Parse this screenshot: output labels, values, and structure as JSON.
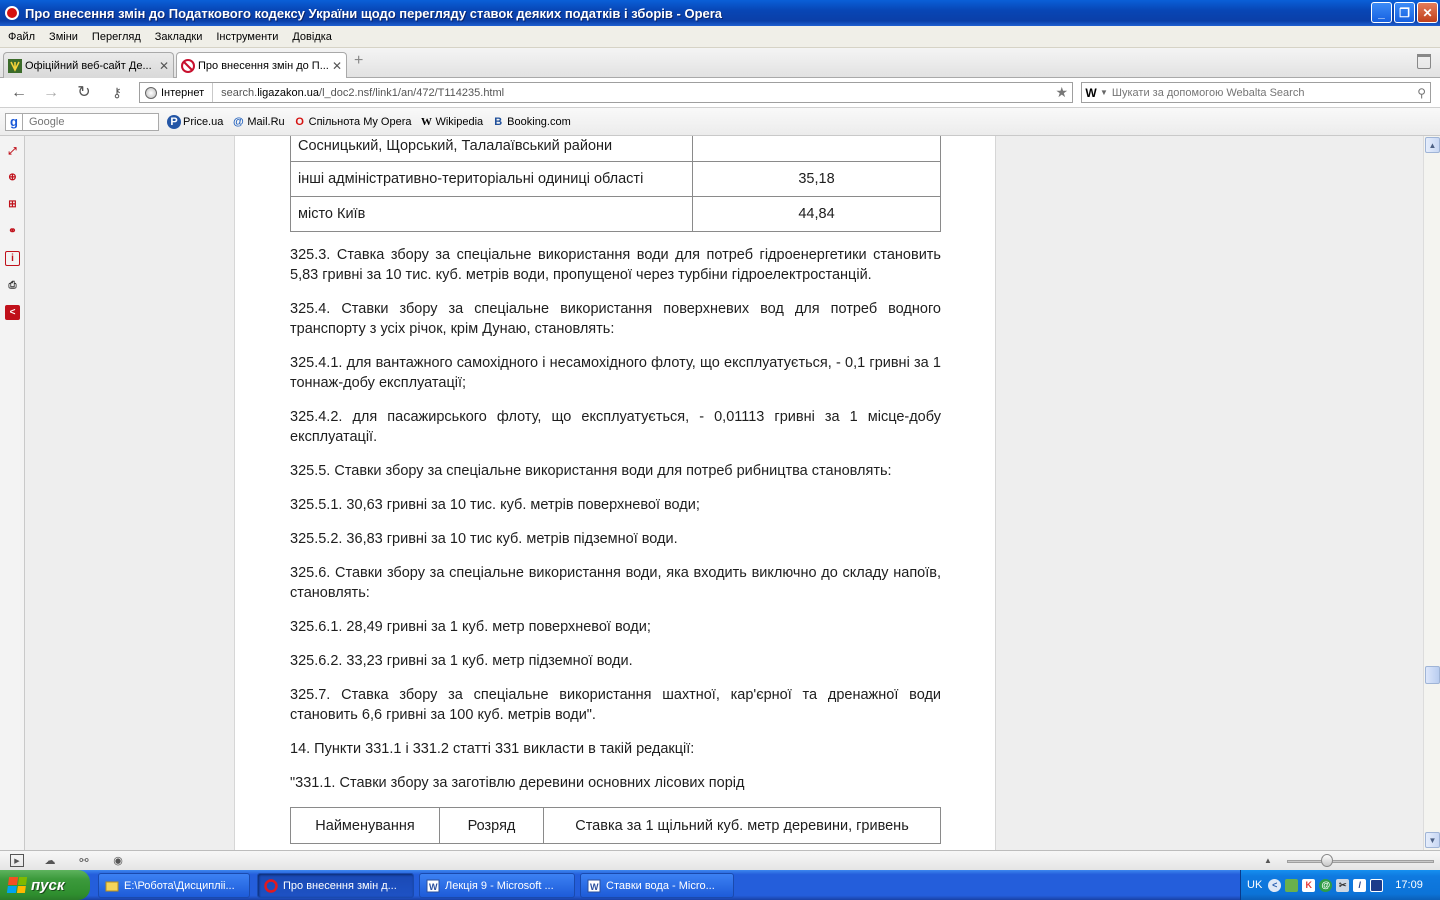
{
  "window": {
    "title": "Про внесення змін до Податкового кодексу України щодо перегляду ставок деяких податків і зборів - Opera"
  },
  "menu": [
    "Файл",
    "Зміни",
    "Перегляд",
    "Закладки",
    "Інструменти",
    "Довідка"
  ],
  "tabs": [
    {
      "label": "Офіційний веб-сайт Де..."
    },
    {
      "label": "Про внесення змін до П..."
    }
  ],
  "address": {
    "security_label": "Інтернет",
    "url_prefix": "search.",
    "url_domain": "ligazakon.ua",
    "url_path": "/l_doc2.nsf/link1/an/472/T114235.html"
  },
  "search": {
    "engine_letter": "W",
    "placeholder": "Шукати за допомогою Webalta Search"
  },
  "bookmarks": {
    "google_placeholder": "Google",
    "items": [
      {
        "label": "Price.ua",
        "icon": "P"
      },
      {
        "label": "Mail.Ru",
        "icon": "@"
      },
      {
        "label": "Спільнота My Opera",
        "icon": "O"
      },
      {
        "label": "Wikipedia",
        "icon": "W"
      },
      {
        "label": "Booking.com",
        "icon": "B"
      }
    ]
  },
  "doc": {
    "rate_rows": [
      {
        "name": "Сосницький, Щорський, Талалаївський райони",
        "value": ""
      },
      {
        "name": "інші адміністративно-територіальні одиниці області",
        "value": "35,18"
      },
      {
        "name": "місто Київ",
        "value": "44,84"
      }
    ],
    "paragraphs": [
      "325.3. Ставка збору за спеціальне використання води для потреб гідроенергетики становить 5,83 гривні за 10 тис. куб. метрів води, пропущеної через турбіни гідроелектростанцій.",
      "325.4. Ставки збору за спеціальне використання поверхневих вод для потреб водного транспорту з усіх річок, крім Дунаю, становлять:",
      "325.4.1. для вантажного самохідного і несамохідного флоту, що експлуатується, - 0,1 гривні за 1 тоннаж-добу експлуатації;",
      "325.4.2. для пасажирського флоту, що експлуатується, - 0,01113 гривні за 1 місце-добу експлуатації.",
      "325.5. Ставки збору за спеціальне використання води для потреб рибництва становлять:",
      "325.5.1. 30,63 гривні за 10 тис. куб. метрів поверхневої води;",
      "325.5.2. 36,83 гривні за 10 тис куб. метрів підземної води.",
      "325.6. Ставки збору за спеціальне використання води, яка входить виключно до складу напоїв, становлять:",
      "325.6.1. 28,49 гривні за 1 куб. метр поверхневої води;",
      "325.6.2. 33,23 гривні за 1 куб. метр підземної води.",
      "325.7. Ставка збору за спеціальне використання шахтної, кар'єрної та дренажної води становить 6,6 гривні за 100 куб. метрів води\".",
      "14. Пункти 331.1 і 331.2 статті 331 викласти в такій редакції:",
      "\"331.1. Ставки збору за заготівлю деревини основних лісових порід"
    ],
    "timber_table_headers": [
      "Найменування",
      "Розряд",
      "Ставка за 1 щільний куб. метр деревини, гривень"
    ]
  },
  "taskbar": {
    "start_label": "пуск",
    "tasks": [
      {
        "label": "E:\\Робота\\Дисципліі..."
      },
      {
        "label": "Про внесення змін д..."
      },
      {
        "label": "Лекція 9 - Microsoft ..."
      },
      {
        "label": "Ставки вода - Micro..."
      }
    ],
    "language": "UK",
    "clock": "17:09"
  },
  "colors": {
    "titlebar": "#0a46b5",
    "taskbar": "#245edb",
    "start": "#3c9a3c",
    "opera_red": "#d5110f"
  }
}
